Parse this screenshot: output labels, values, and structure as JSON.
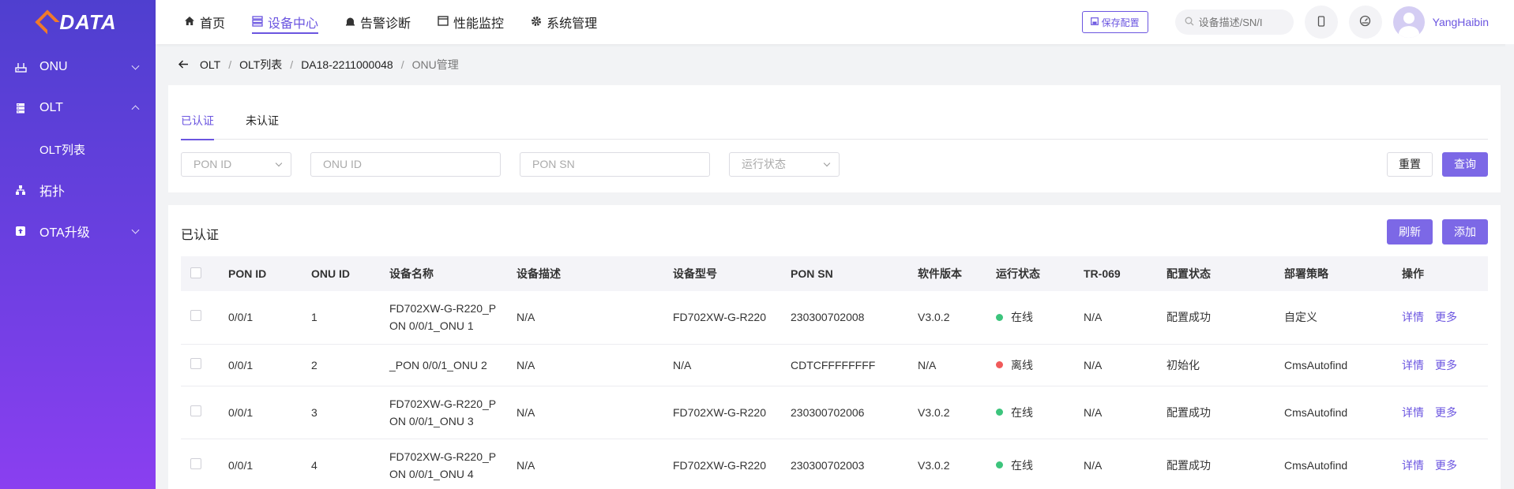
{
  "brand": {
    "logo_text": "DATA",
    "logo_color": "#f07a2a",
    "accent": "#6b55e0"
  },
  "sidebar": {
    "items": [
      {
        "label": "ONU",
        "icon": "router-icon",
        "expanded": false
      },
      {
        "label": "OLT",
        "icon": "server-icon",
        "expanded": true,
        "children": [
          {
            "label": "OLT列表"
          }
        ]
      },
      {
        "label": "拓扑",
        "icon": "topology-icon"
      },
      {
        "label": "OTA升级",
        "icon": "upload-icon",
        "expanded": false
      }
    ]
  },
  "topnav": {
    "items": [
      {
        "label": "首页",
        "icon": "home-icon"
      },
      {
        "label": "设备中心",
        "icon": "device-icon",
        "active": true
      },
      {
        "label": "告警诊断",
        "icon": "alarm-icon"
      },
      {
        "label": "性能监控",
        "icon": "monitor-icon"
      },
      {
        "label": "系统管理",
        "icon": "gear-icon"
      }
    ],
    "save_label": "保存配置",
    "search_placeholder": "设备描述/SN/I",
    "username": "YangHaibin"
  },
  "breadcrumb": [
    "OLT",
    "OLT列表",
    "DA18-2211000048",
    "ONU管理"
  ],
  "tabs": [
    {
      "label": "已认证",
      "active": true
    },
    {
      "label": "未认证"
    }
  ],
  "filters": {
    "pon_id_placeholder": "PON ID",
    "onu_id_placeholder": "ONU ID",
    "pon_sn_placeholder": "PON SN",
    "status_placeholder": "运行状态",
    "reset_label": "重置",
    "query_label": "查询"
  },
  "table": {
    "title": "已认证",
    "refresh_label": "刷新",
    "add_label": "添加",
    "columns": [
      "PON ID",
      "ONU ID",
      "设备名称",
      "设备描述",
      "设备型号",
      "PON SN",
      "软件版本",
      "运行状态",
      "TR-069",
      "配置状态",
      "部署策略",
      "操作"
    ],
    "status_colors": {
      "online": "#3cc47c",
      "offline": "#f05a5a"
    },
    "rows": [
      {
        "pon_id": "0/0/1",
        "onu_id": "1",
        "name_l1": "FD702XW-G-R220_P",
        "name_l2": "ON 0/0/1_ONU 1",
        "desc": "N/A",
        "model": "FD702XW-G-R220",
        "pon_sn": "230300702008",
        "version": "V3.0.2",
        "status": "在线",
        "status_key": "online",
        "tr069": "N/A",
        "config": "配置成功",
        "policy": "自定义",
        "detail": "详情",
        "more": "更多"
      },
      {
        "pon_id": "0/0/1",
        "onu_id": "2",
        "name_l1": "_PON 0/0/1_ONU 2",
        "name_l2": "",
        "desc": "N/A",
        "model": "N/A",
        "pon_sn": "CDTCFFFFFFFF",
        "version": "N/A",
        "status": "离线",
        "status_key": "offline",
        "tr069": "N/A",
        "config": "初始化",
        "policy": "CmsAutofind",
        "detail": "详情",
        "more": "更多"
      },
      {
        "pon_id": "0/0/1",
        "onu_id": "3",
        "name_l1": "FD702XW-G-R220_P",
        "name_l2": "ON 0/0/1_ONU 3",
        "desc": "N/A",
        "model": "FD702XW-G-R220",
        "pon_sn": "230300702006",
        "version": "V3.0.2",
        "status": "在线",
        "status_key": "online",
        "tr069": "N/A",
        "config": "配置成功",
        "policy": "CmsAutofind",
        "detail": "详情",
        "more": "更多"
      },
      {
        "pon_id": "0/0/1",
        "onu_id": "4",
        "name_l1": "FD702XW-G-R220_P",
        "name_l2": "ON 0/0/1_ONU 4",
        "desc": "N/A",
        "model": "FD702XW-G-R220",
        "pon_sn": "230300702003",
        "version": "V3.0.2",
        "status": "在线",
        "status_key": "online",
        "tr069": "N/A",
        "config": "配置成功",
        "policy": "CmsAutofind",
        "detail": "详情",
        "more": "更多"
      }
    ]
  }
}
